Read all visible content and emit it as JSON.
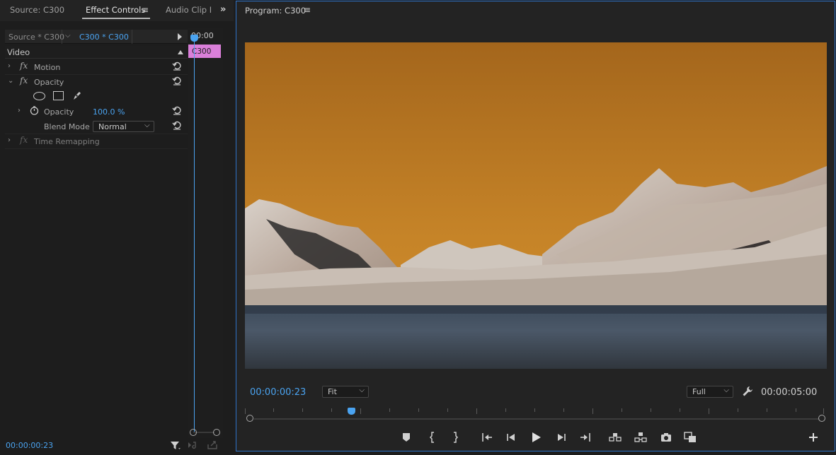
{
  "tabs": {
    "source": "Source: C300",
    "effect_controls": "Effect Controls",
    "effect_controls_menu": "≡",
    "audio_clip": "Audio Clip I"
  },
  "effect_controls": {
    "source_label": "Source * C300",
    "clip_label": "C300 * C300",
    "section_title": "Video",
    "motion": "Motion",
    "opacity": "Opacity",
    "opacity_property": "Opacity",
    "opacity_value": "100.0 %",
    "blend_mode_label": "Blend Mode",
    "blend_mode_value": "Normal",
    "time_remapping": "Time Remapping",
    "mini_timeline_time": "00:00",
    "mini_clip_label": "C300",
    "current_time": "00:00:00:23"
  },
  "program": {
    "title": "Program: C300",
    "menu": "≡",
    "current_time": "00:00:00:23",
    "zoom": "Fit",
    "resolution": "Full",
    "duration": "00:00:05:00",
    "playhead_fraction": 0.18
  },
  "colors": {
    "accent": "#4aa3f0",
    "clip_pink": "#da7fd9",
    "panel_border": "#2e73c8"
  }
}
